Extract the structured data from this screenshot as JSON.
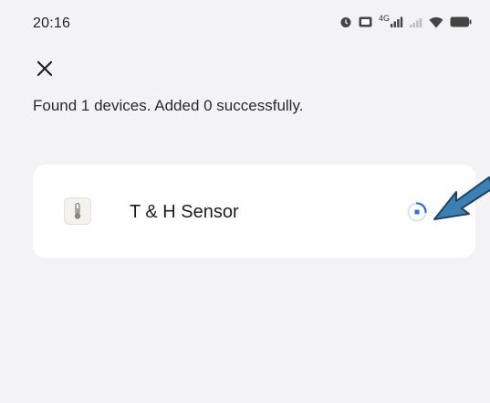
{
  "status_bar": {
    "time": "20:16",
    "network_label": "4G",
    "icons": [
      "alarm-icon",
      "hd-icon",
      "signal-icon",
      "signal-weak-icon",
      "wifi-icon",
      "battery-icon"
    ],
    "battery_text": "95"
  },
  "header": {
    "close_icon": "close-icon"
  },
  "message": {
    "text": "Found 1 devices. Added 0 successfully."
  },
  "device": {
    "name": "T & H Sensor",
    "icon": "thermometer-icon",
    "status": "loading"
  },
  "colors": {
    "background": "#f3f3f5",
    "card": "#ffffff",
    "spinner": "#2f6fd6",
    "arrow": "#3c7fb5"
  }
}
